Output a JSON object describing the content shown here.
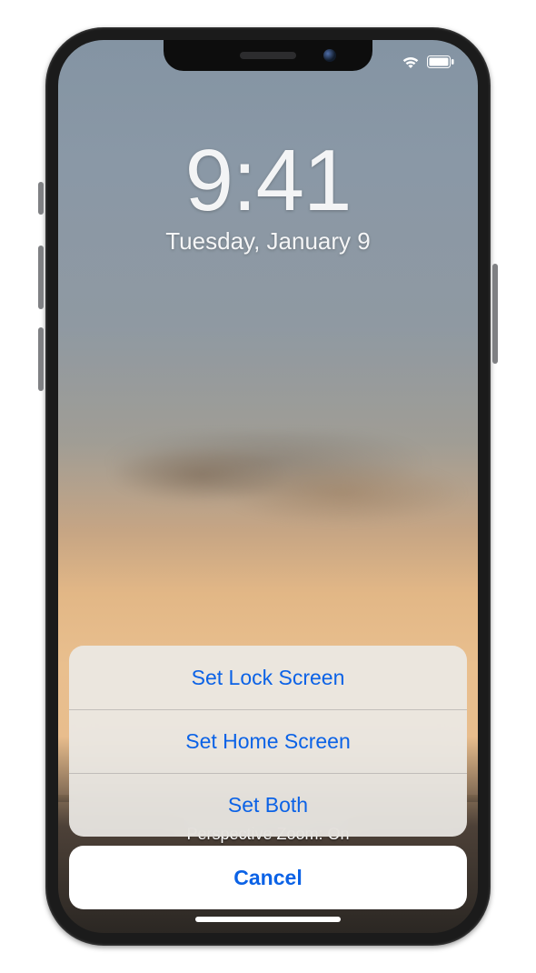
{
  "status": {
    "wifi_icon": "wifi",
    "battery_icon": "battery-full"
  },
  "lock": {
    "time": "9:41",
    "date": "Tuesday, January 9"
  },
  "zoom_caption": "Perspective Zoom: On",
  "action_sheet": {
    "options": [
      {
        "label": "Set Lock Screen"
      },
      {
        "label": "Set Home Screen"
      },
      {
        "label": "Set Both"
      }
    ],
    "cancel_label": "Cancel"
  },
  "colors": {
    "ios_blue": "#0b62e6"
  }
}
